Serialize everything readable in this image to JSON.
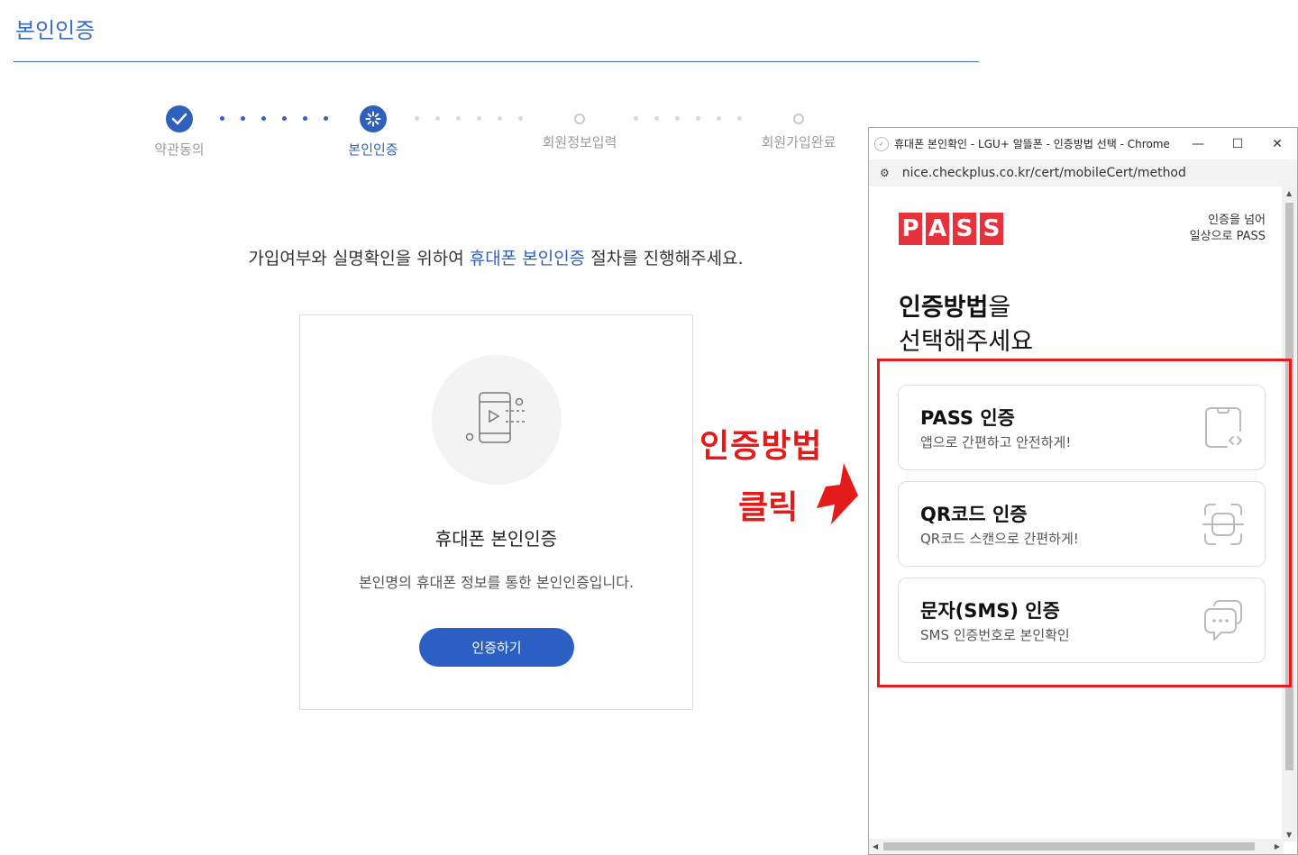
{
  "page": {
    "title": "본인인증"
  },
  "steps": [
    {
      "label": "약관동의",
      "state": "done"
    },
    {
      "label": "본인인증",
      "state": "active"
    },
    {
      "label": "회원정보입력",
      "state": "pending"
    },
    {
      "label": "회원가입완료",
      "state": "pending"
    }
  ],
  "intro": {
    "before": "가입여부와 실명확인을 위하여 ",
    "highlight": "휴대폰 본인인증",
    "after": " 절차를 진행해주세요."
  },
  "card": {
    "icon": "phone-play-icon",
    "title": "휴대폰 본인인증",
    "description": "본인명의 휴대폰 정보를 통한 본인인증입니다.",
    "button": "인증하기"
  },
  "annotation": {
    "main": "인증방법",
    "sub": "클릭",
    "color": "#e31b1b"
  },
  "popup": {
    "window_title": "휴대폰 본인확인 - LGU+ 알뜰폰 - 인증방법 선택 - Chrome",
    "url": "nice.checkplus.co.kr/cert/mobileCert/method",
    "logo_letters": [
      "P",
      "A",
      "S",
      "S"
    ],
    "tagline_line1": "인증을 넘어",
    "tagline_line2": "일상으로 PASS",
    "heading_bold": "인증방법",
    "heading_rest": "을",
    "heading_line2": "선택해주세요",
    "methods": [
      {
        "title": "PASS 인증",
        "desc": "앱으로 간편하고 안전하게!",
        "icon": "phone-code-icon"
      },
      {
        "title": "QR코드 인증",
        "desc": "QR코드 스캔으로 간편하게!",
        "icon": "qr-scan-icon"
      },
      {
        "title": "문자(SMS) 인증",
        "desc": "SMS 인증번호로 본인확인",
        "icon": "chat-bubbles-icon"
      }
    ]
  },
  "colors": {
    "brand_blue": "#2f60bd",
    "pass_red": "#e8323b",
    "highlight_red": "#e31b1b"
  }
}
